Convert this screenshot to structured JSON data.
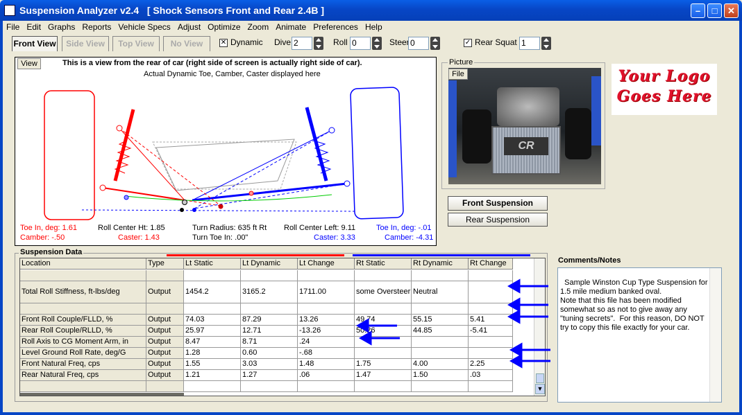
{
  "window": {
    "title": "Suspension Analyzer v2.4   [ Shock Sensors Front and Rear 2.4B ]"
  },
  "menu": [
    "File",
    "Edit",
    "Graphs",
    "Reports",
    "Vehicle Specs",
    "Adjust",
    "Optimize",
    "Zoom",
    "Animate",
    "Preferences",
    "Help"
  ],
  "tabs": {
    "front": "Front View",
    "side": "Side View",
    "top": "Top View",
    "none": "No View"
  },
  "toolbar": {
    "dynamic_label": "Dynamic",
    "dynamic_checked": true,
    "dive_label": "Dive",
    "dive_value": "2",
    "roll_label": "Roll",
    "roll_value": "0",
    "steer_label": "Steer",
    "steer_value": "0",
    "rear_squat_label": "Rear Squat",
    "rear_squat_checked": true,
    "rear_squat_value": "1"
  },
  "view": {
    "button": "View",
    "header": "This is a view from the rear of car (right side of screen is actually right side of car).",
    "subheader": "Actual Dynamic Toe, Camber, Caster displayed here",
    "toe_left": "Toe In, deg: 1.61",
    "camber_left": "Camber: -.50",
    "roll_center_ht": "Roll Center Ht: 1.85",
    "caster_left": "Caster: 1.43",
    "turn_radius": "Turn Radius: 635 ft Rt",
    "turn_toe_in": "Turn Toe In: .00\"",
    "roll_center_left": "Roll Center Left: 9.11",
    "caster_right": "Caster: 3.33",
    "toe_right": "Toe In, deg: -.01",
    "camber_right": "Camber: -4.31"
  },
  "picture": {
    "label": "Picture",
    "file_button": "File"
  },
  "buttons": {
    "front_suspension": "Front Suspension",
    "rear_suspension": "Rear Suspension"
  },
  "logo": {
    "line1": "Your Logo",
    "line2": "Goes Here"
  },
  "suspension_data": {
    "label": "Suspension Data",
    "columns": [
      "Location",
      "Type",
      "Lt Static",
      "Lt Dynamic",
      "Lt Change",
      "Rt Static",
      "Rt Dynamic",
      "Rt Change"
    ],
    "rows": [
      [
        "",
        "",
        "",
        "",
        "",
        "",
        "",
        ""
      ],
      [
        "Total Roll Stiffness, ft-lbs/deg",
        "Output",
        "1454.2",
        "3165.2",
        "1711.00",
        "some Oversteer",
        "Neutral",
        ""
      ],
      [
        "",
        "",
        "",
        "",
        "",
        "",
        "",
        ""
      ],
      [
        "Front Roll Couple/FLLD, %",
        "Output",
        "74.03",
        "87.29",
        "13.26",
        "49.74",
        "55.15",
        "5.41"
      ],
      [
        "Rear Roll Couple/RLLD, %",
        "Output",
        "25.97",
        "12.71",
        "-13.26",
        "50.26",
        "44.85",
        "-5.41"
      ],
      [
        "Roll Axis to CG Moment Arm, in",
        "Output",
        "8.47",
        "8.71",
        ".24",
        "",
        "",
        ""
      ],
      [
        "Level Ground Roll Rate, deg/G",
        "Output",
        "1.28",
        "0.60",
        "-.68",
        "",
        "",
        ""
      ],
      [
        "Front Natural Freq, cps",
        "Output",
        "1.55",
        "3.03",
        "1.48",
        "1.75",
        "4.00",
        "2.25"
      ],
      [
        "Rear Natural Freq, cps",
        "Output",
        "1.21",
        "1.27",
        ".06",
        "1.47",
        "1.50",
        ".03"
      ],
      [
        "",
        "",
        "",
        "",
        "",
        "",
        "",
        ""
      ]
    ]
  },
  "notes": {
    "label": "Comments/Notes",
    "text": "Sample Winston Cup Type Suspension for 1.5 mile medium banked oval.\nNote that this file has been modified somewhat so as not to give away any \"tuning secrets\".  For this reason, DO NOT try to copy this file exactly for your car."
  },
  "colors": {
    "left": "#ff0000",
    "right": "#0000ff",
    "title_bar": "#0746c6"
  }
}
